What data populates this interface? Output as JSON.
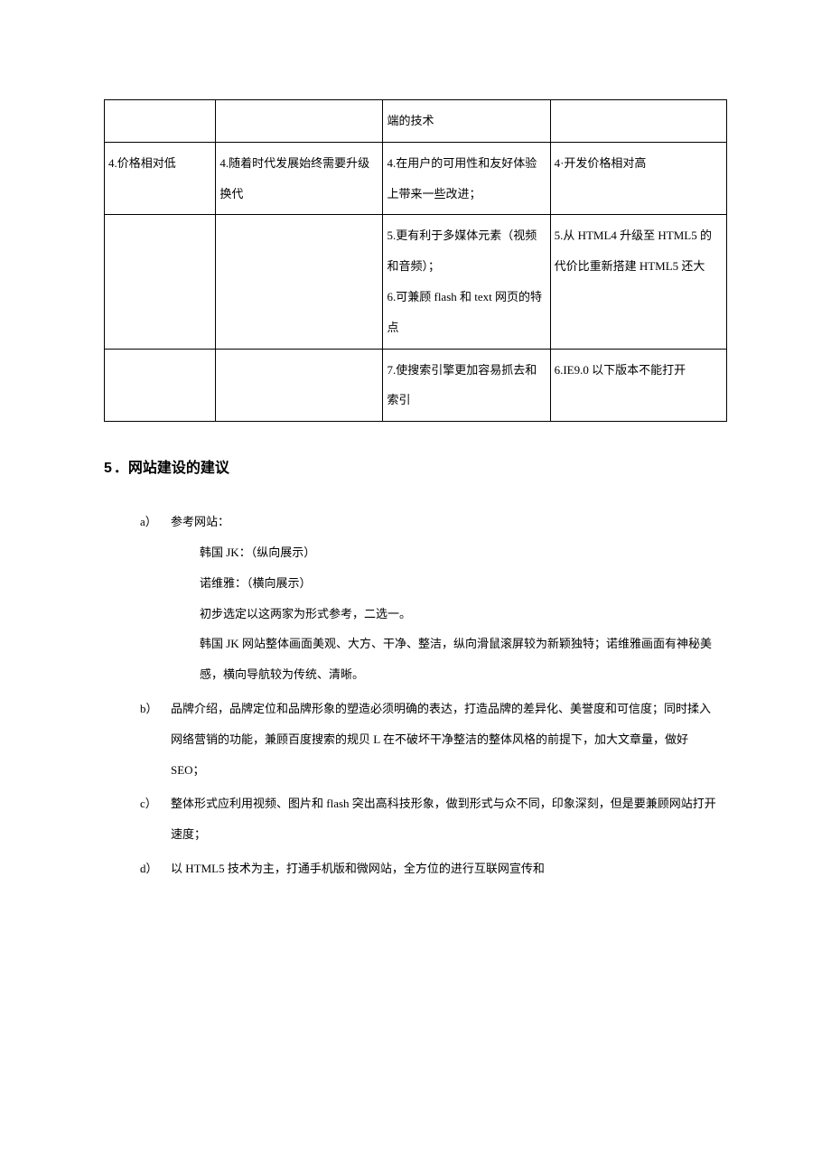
{
  "table": {
    "rows": [
      {
        "c1": "",
        "c2": "",
        "c3": "端的技术",
        "c4": ""
      },
      {
        "c1": "4.价格相对低",
        "c2": "4.随着时代发展始终需要升级换代",
        "c3": "4.在用户的可用性和友好体验上带来一些改进；",
        "c4": "4·开发价格相对高"
      },
      {
        "c1": "",
        "c2": "",
        "c3": "5.更有利于多媒体元素（视频和音频）；\n6.可兼顾 flash 和 text 网页的特点",
        "c4": "5.从 HTML4 升级至 HTML5 的代价比重新搭建 HTML5 还大"
      },
      {
        "c1": "",
        "c2": "",
        "c3": "7.使搜索引擎更加容易抓去和索引",
        "c4": "6.IE9.0 以下版本不能打开"
      }
    ]
  },
  "heading": {
    "number": "5",
    "title": "．网站建设的建议"
  },
  "items": {
    "a": {
      "label": "a）",
      "intro": "参考网站：",
      "lines": [
        "韩国 JK：（纵向展示）",
        "诺维雅：（横向展示）",
        "初步选定以这两家为形式参考，二选一。",
        "韩国 JK 网站整体画面美观、大方、干净、整洁，纵向滑鼠滚屏较为新颖独特；诺维雅画面有神秘美感，横向导航较为传统、清晰。"
      ]
    },
    "b": {
      "label": "b）",
      "text": "品牌介绍，品牌定位和品牌形象的塑造必须明确的表达，打造品牌的差异化、美誉度和可信度；同时揉入网络营销的功能，兼顾百度搜索的规贝 L 在不破坏干净整洁的整体风格的前提下，加大文章量，做好 SEO；"
    },
    "c": {
      "label": "c）",
      "text": "整体形式应利用视频、图片和 flash 突出高科技形象，做到形式与众不同，印象深刻，但是要兼顾网站打开速度；"
    },
    "d": {
      "label": "d）",
      "text": "以 HTML5 技术为主，打通手机版和微网站，全方位的进行互联网宣传和"
    }
  }
}
